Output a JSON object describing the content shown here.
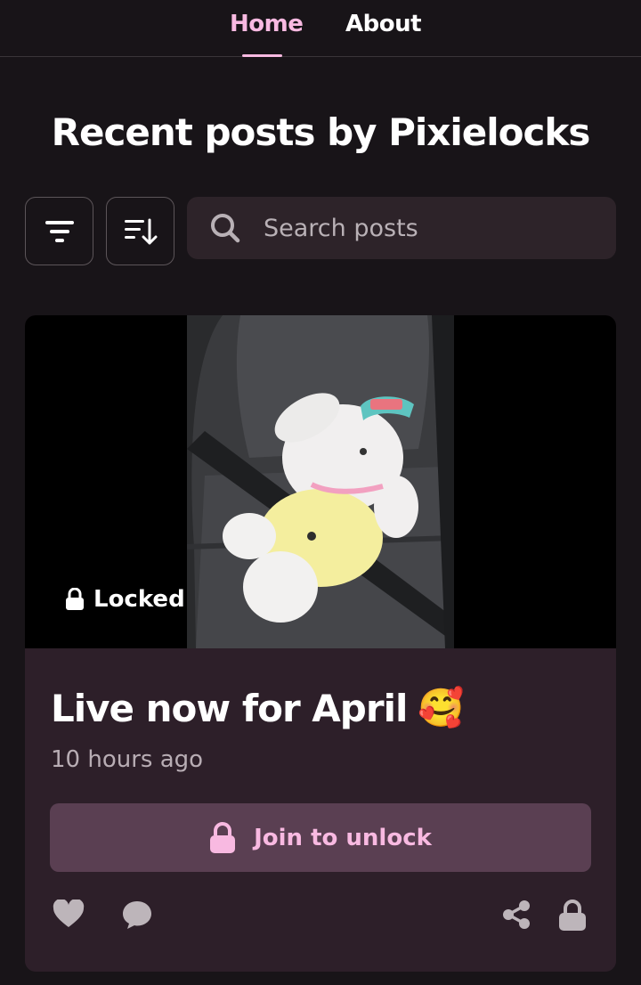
{
  "nav": {
    "tabs": [
      {
        "label": "Home",
        "active": true
      },
      {
        "label": "About",
        "active": false
      }
    ]
  },
  "page": {
    "title": "Recent posts by Pixielocks"
  },
  "toolbar": {
    "filter_icon": "filter-icon",
    "sort_icon": "sort-icon",
    "search_placeholder": "Search posts",
    "search_value": ""
  },
  "post": {
    "image_description_icon": "plush-bunny-photo",
    "locked_label": "Locked",
    "title": "Live now for April",
    "title_emoji": "🥰",
    "time": "10 hours ago",
    "unlock_label": "Join to unlock",
    "actions": [
      "heart-icon",
      "comment-icon",
      "share-icon",
      "lock-icon"
    ]
  },
  "colors": {
    "background": "#181418",
    "accent": "#f8b9e1",
    "card": "#2d1f29",
    "button": "#5a3f52"
  }
}
